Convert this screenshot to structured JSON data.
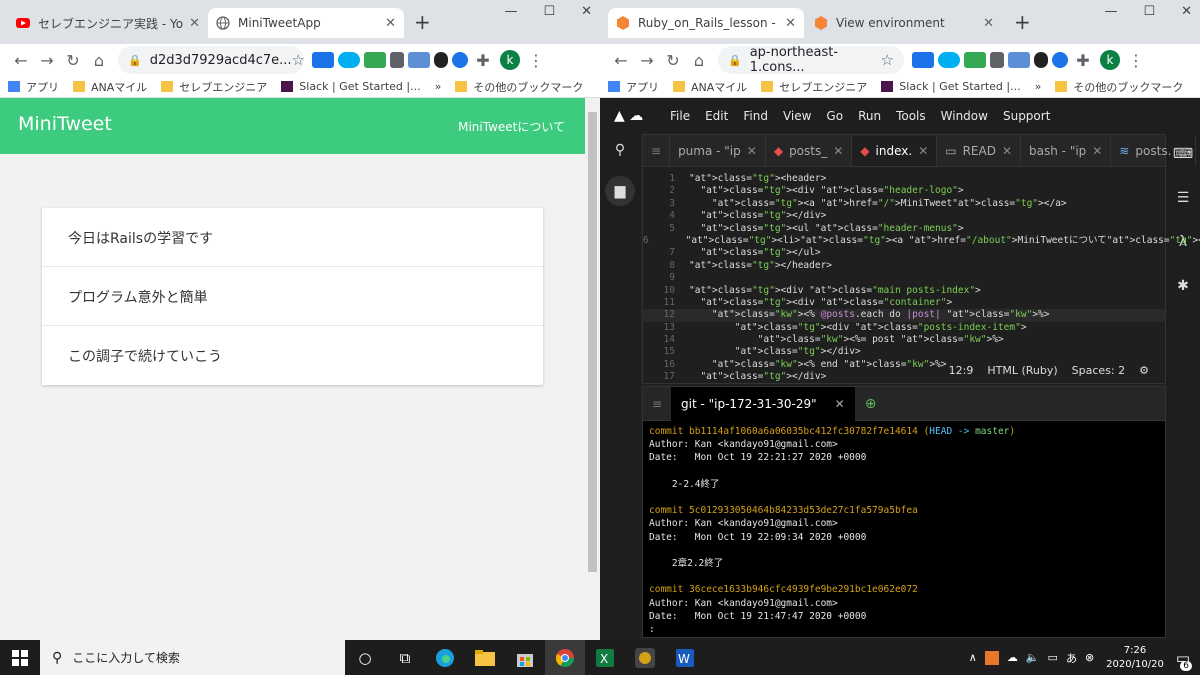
{
  "left_browser": {
    "tabs": [
      {
        "title": "セレブエンジニア実践 - YouTube",
        "icon": "youtube-icon",
        "active": false
      },
      {
        "title": "MiniTweetApp",
        "icon": "globe-icon",
        "active": true
      }
    ],
    "url": "d2d3d7929acd4c7e...",
    "bookmarks": [
      "アプリ",
      "ANAマイル",
      "セレブエンジニア",
      "Slack | Get Started |...",
      "»",
      "その他のブックマーク"
    ],
    "page": {
      "logo": "MiniTweet",
      "menu": "MiniTweetについて",
      "posts": [
        "今日はRailsの学習です",
        "プログラム意外と簡単",
        "この調子で続けていこう"
      ]
    }
  },
  "right_browser": {
    "tabs": [
      {
        "title": "Ruby_on_Rails_lesson - AWS C",
        "icon": "aws-icon",
        "active": true
      },
      {
        "title": "View environment",
        "icon": "aws-icon",
        "active": false
      }
    ],
    "url": "ap-northeast-1.cons...",
    "bookmarks": [
      "アプリ",
      "ANAマイル",
      "セレブエンジニア",
      "Slack | Get Started |...",
      "»",
      "その他のブックマーク"
    ],
    "ide_menu": [
      "File",
      "Edit",
      "Find",
      "View",
      "Go",
      "Run",
      "Tools",
      "Window",
      "Support"
    ],
    "editor_tabs": [
      "puma - \"ip",
      "posts_",
      "index.",
      "READ",
      "bash - \"ip",
      "posts."
    ],
    "code_lines": [
      {
        "n": "1",
        "t": "<header>"
      },
      {
        "n": "2",
        "t": "  <div class=\"header-logo\">"
      },
      {
        "n": "3",
        "t": "    <a href=\"/\">MiniTweet</a>"
      },
      {
        "n": "4",
        "t": "  </div>"
      },
      {
        "n": "5",
        "t": "  <ul class=\"header-menus\">"
      },
      {
        "n": "6",
        "t": "    <li><a href=\"/about\">MiniTweetについて</a></li>"
      },
      {
        "n": "7",
        "t": "  </ul>"
      },
      {
        "n": "8",
        "t": "</header>"
      },
      {
        "n": "9",
        "t": ""
      },
      {
        "n": "10",
        "t": "<div class=\"main posts-index\">"
      },
      {
        "n": "11",
        "t": "  <div class=\"container\">"
      },
      {
        "n": "12",
        "t": "    <% @posts.each do |post| %>"
      },
      {
        "n": "13",
        "t": "        <div class=\"posts-index-item\">"
      },
      {
        "n": "14",
        "t": "            <%= post %>"
      },
      {
        "n": "15",
        "t": "        </div>"
      },
      {
        "n": "16",
        "t": "    <% end %>"
      },
      {
        "n": "17",
        "t": "  </div>"
      }
    ],
    "status": {
      "pos": "12:9",
      "mode": "HTML (Ruby)",
      "spaces": "Spaces: 2"
    },
    "terminal_tab": "git - \"ip-172-31-30-29\"",
    "terminal": [
      {
        "type": "commit",
        "hash": "commit bb1114af1060a6a06035bc412fc30782f7e14614",
        "ref": true
      },
      {
        "type": "text",
        "t": "Author: Kan <kandayo91@gmail.com>"
      },
      {
        "type": "text",
        "t": "Date:   Mon Oct 19 22:21:27 2020 +0000"
      },
      {
        "type": "text",
        "t": ""
      },
      {
        "type": "text",
        "t": "    2-2.4終了"
      },
      {
        "type": "text",
        "t": ""
      },
      {
        "type": "commit",
        "hash": "commit 5c012933050464b84233d53de27c1fa579a5bfea",
        "ref": false
      },
      {
        "type": "text",
        "t": "Author: Kan <kandayo91@gmail.com>"
      },
      {
        "type": "text",
        "t": "Date:   Mon Oct 19 22:09:34 2020 +0000"
      },
      {
        "type": "text",
        "t": ""
      },
      {
        "type": "text",
        "t": "    2章2.2終了"
      },
      {
        "type": "text",
        "t": ""
      },
      {
        "type": "commit",
        "hash": "commit 36cece1633b946cfc4939fe9be291bc1e062e072",
        "ref": false
      },
      {
        "type": "text",
        "t": "Author: Kan <kandayo91@gmail.com>"
      },
      {
        "type": "text",
        "t": "Date:   Mon Oct 19 21:47:47 2020 +0000"
      },
      {
        "type": "text",
        "t": ":"
      }
    ],
    "head_ref": "(HEAD -> master)"
  },
  "taskbar": {
    "search_placeholder": "ここに入力して検索",
    "time": "7:26",
    "date": "2020/10/20",
    "ime": "あ",
    "notifications": "6"
  }
}
